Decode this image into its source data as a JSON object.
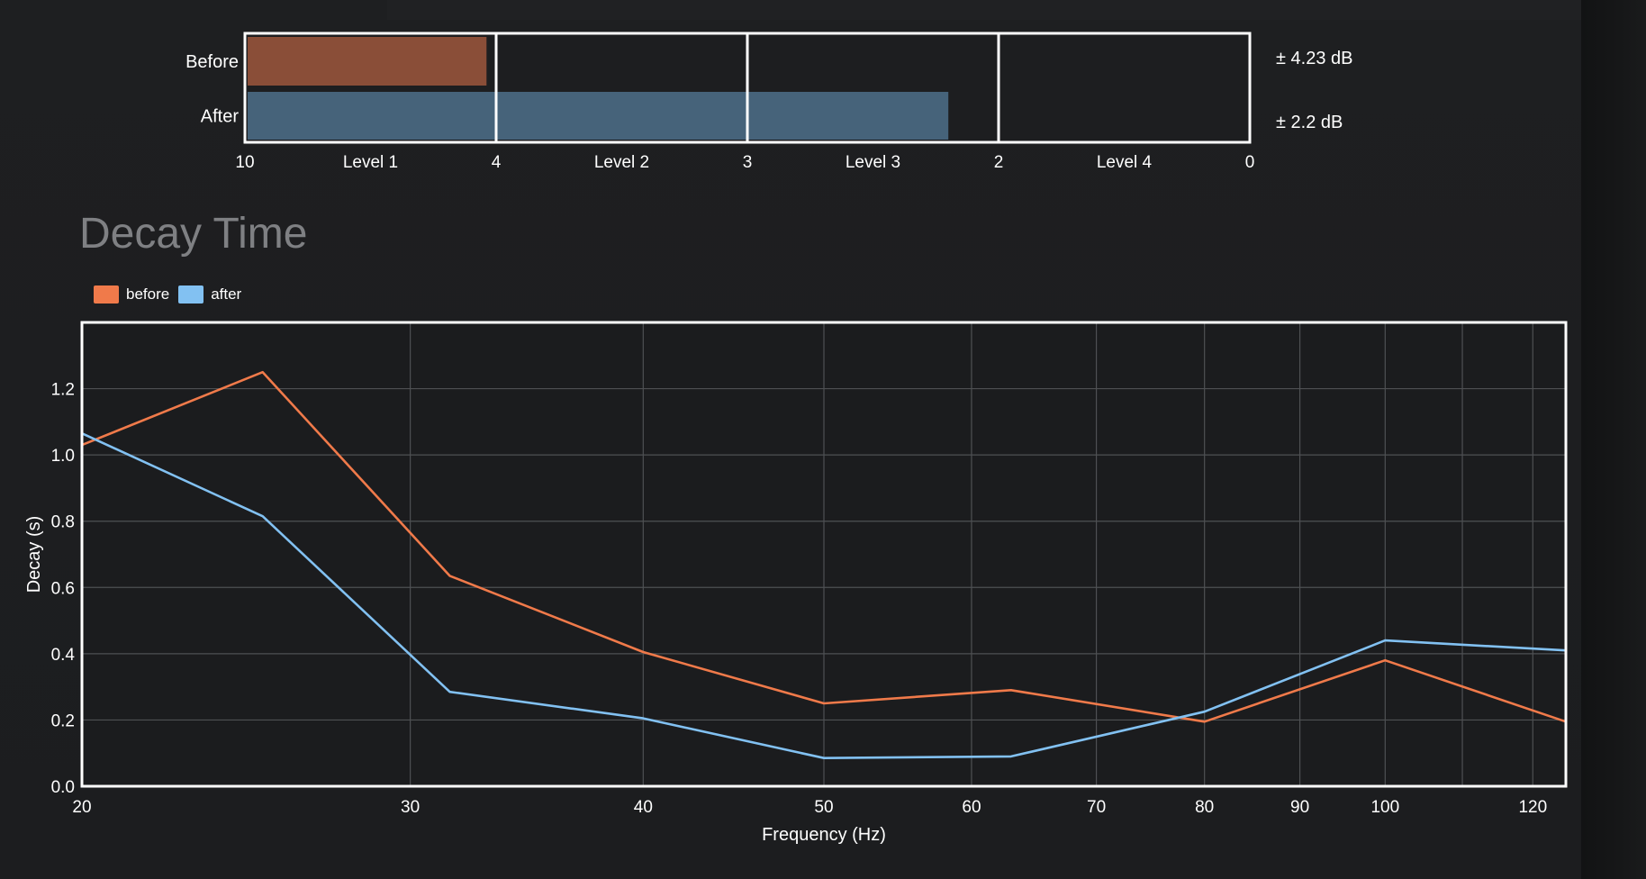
{
  "level_meter": {
    "rows": [
      {
        "label": "Before",
        "value": 4.23,
        "readout": "± 4.23 dB",
        "color": "#8a4e38"
      },
      {
        "label": "After",
        "value": 2.2,
        "readout": "± 2.2 dB",
        "color": "#46637a"
      }
    ],
    "scale": {
      "min": 10,
      "max": 0
    },
    "boundaries": [
      {
        "value": 10,
        "label": "10"
      },
      {
        "value": 4,
        "label": "4"
      },
      {
        "value": 3,
        "label": "3"
      },
      {
        "value": 2,
        "label": "2"
      },
      {
        "value": 0,
        "label": "0"
      }
    ],
    "levels": [
      "Level 1",
      "Level 2",
      "Level 3",
      "Level 4"
    ]
  },
  "section": {
    "title": "Decay Time"
  },
  "chart_data": {
    "type": "line",
    "title": "",
    "xlabel": "Frequency (Hz)",
    "ylabel": "Decay (s)",
    "x_scale": "log",
    "xlim": [
      20,
      125
    ],
    "ylim": [
      0,
      1.4
    ],
    "x_ticks": [
      20,
      30,
      40,
      50,
      60,
      70,
      80,
      90,
      100,
      120
    ],
    "x_minor_grid": [
      110
    ],
    "y_ticks": [
      "0.0",
      "0.2",
      "0.4",
      "0.6",
      "0.8",
      "1.0",
      "1.2"
    ],
    "grid": true,
    "legend_position": "top-left",
    "series": [
      {
        "name": "before",
        "color": "#f07a4a",
        "x": [
          20,
          25,
          31.5,
          40,
          50,
          63,
          80,
          100,
          125
        ],
        "values": [
          1.03,
          1.25,
          0.635,
          0.405,
          0.25,
          0.29,
          0.195,
          0.38,
          0.195
        ]
      },
      {
        "name": "after",
        "color": "#82c1f2",
        "x": [
          20,
          25,
          31.5,
          40,
          50,
          63,
          80,
          100,
          125
        ],
        "values": [
          1.065,
          0.815,
          0.285,
          0.205,
          0.085,
          0.09,
          0.225,
          0.44,
          0.41
        ]
      }
    ]
  }
}
